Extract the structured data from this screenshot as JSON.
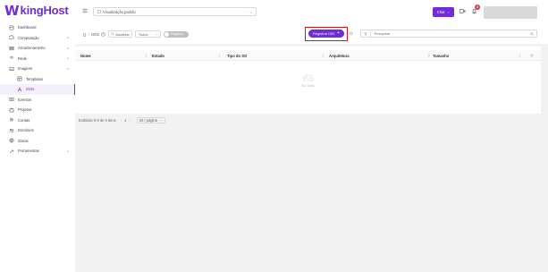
{
  "brand": {
    "logo_text": "kingHost",
    "accent": "#6f2cd8"
  },
  "sidebar": {
    "items": [
      {
        "label": "Dashboard",
        "icon": "dashboard-icon"
      },
      {
        "label": "Computação",
        "icon": "compute-icon",
        "expandable": true
      },
      {
        "label": "Armazenamento",
        "icon": "storage-icon",
        "expandable": true
      },
      {
        "label": "Rede",
        "icon": "network-icon",
        "expandable": true
      },
      {
        "label": "Imagens",
        "icon": "images-icon",
        "expandable": true,
        "expanded": true
      },
      {
        "label": "Templates",
        "icon": "template-icon",
        "sub": true
      },
      {
        "label": "ISOs",
        "icon": "iso-icon",
        "sub": true,
        "active": true
      },
      {
        "label": "Eventos",
        "icon": "events-icon"
      },
      {
        "label": "Projetos",
        "icon": "projects-icon"
      },
      {
        "label": "Contas",
        "icon": "accounts-icon"
      },
      {
        "label": "Domínios",
        "icon": "domains-icon"
      },
      {
        "label": "Zonas",
        "icon": "zones-icon"
      },
      {
        "label": "Ferramentas",
        "icon": "tools-icon",
        "expandable": true
      }
    ]
  },
  "topbar": {
    "view_select": "Visualização padrão",
    "create_label": "Criar",
    "notification_count": "3"
  },
  "toolbar": {
    "breadcrumb_current": "ISOs",
    "refresh_label": "Atualizar",
    "filter_label": "Todos",
    "toggle_label": "Registro",
    "register_label": "Registrar ISO",
    "search_placeholder": "Pesquisar"
  },
  "table": {
    "columns": [
      "Nome",
      "Estado",
      "Tipo do SO",
      "Arquitetura",
      "Tamanho"
    ],
    "empty_text": "No Data"
  },
  "pagination": {
    "summary": "Exibindo 0-0 de 0 itens",
    "current_page": "1",
    "page_size": "20 / página"
  }
}
